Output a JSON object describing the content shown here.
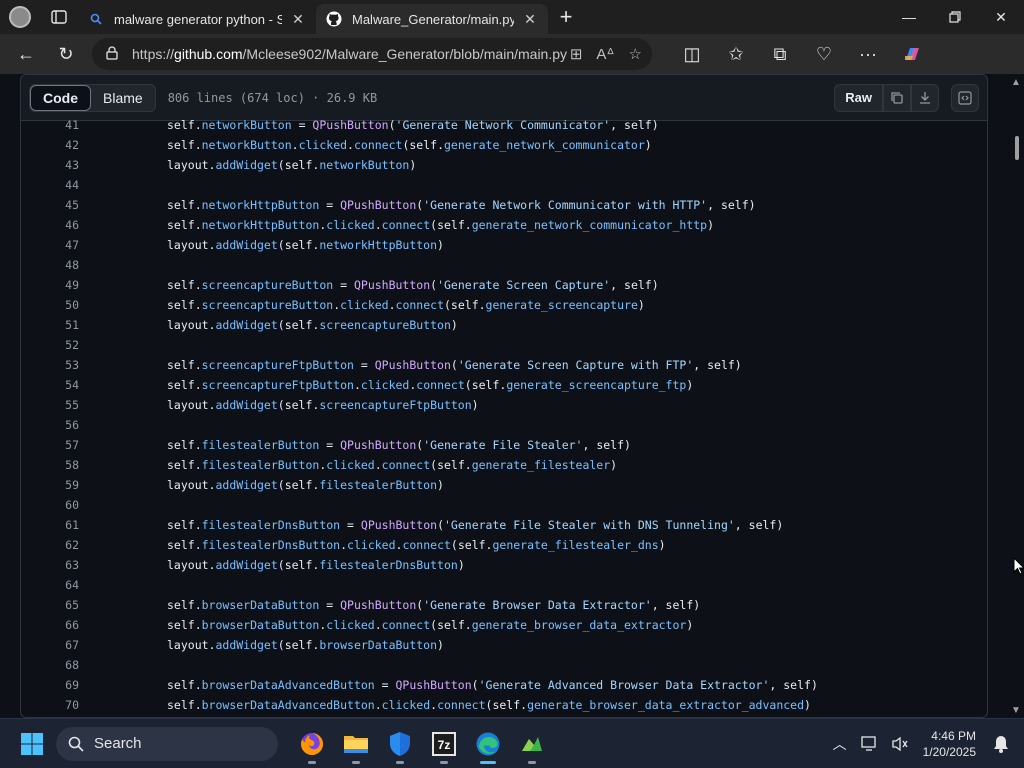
{
  "browser": {
    "tabs": [
      {
        "title": "malware generator python - Sear",
        "favicon": "search-icon",
        "active": false
      },
      {
        "title": "Malware_Generator/main.py at m",
        "favicon": "github-icon",
        "active": true
      }
    ],
    "address": {
      "scheme": "https://",
      "host": "github.com",
      "path": "/Mcleese902/Malware_Generator/blob/main/main.py"
    }
  },
  "file": {
    "tabs": [
      "Code",
      "Blame"
    ],
    "selected_tab": "Code",
    "meta": "806 lines (674 loc) · 26.9 KB",
    "raw_label": "Raw"
  },
  "code_lines": [
    {
      "n": "41",
      "tokens": [
        [
          "self.",
          "kw"
        ],
        [
          "networkButton",
          "attr"
        ],
        [
          " = ",
          "kw"
        ],
        [
          "QPushButton",
          "fn"
        ],
        [
          "(",
          "kw"
        ],
        [
          "'Generate Network Communicator'",
          "str"
        ],
        [
          ", self)",
          "kw"
        ]
      ]
    },
    {
      "n": "42",
      "tokens": [
        [
          "self.",
          "kw"
        ],
        [
          "networkButton",
          "attr"
        ],
        [
          ".",
          "kw"
        ],
        [
          "clicked",
          "attr"
        ],
        [
          ".",
          "kw"
        ],
        [
          "connect",
          "attr"
        ],
        [
          "(self.",
          "kw"
        ],
        [
          "generate_network_communicator",
          "attr"
        ],
        [
          ")",
          "kw"
        ]
      ]
    },
    {
      "n": "43",
      "tokens": [
        [
          "layout.",
          "kw"
        ],
        [
          "addWidget",
          "attr"
        ],
        [
          "(self.",
          "kw"
        ],
        [
          "networkButton",
          "attr"
        ],
        [
          ")",
          "kw"
        ]
      ]
    },
    {
      "n": "44",
      "tokens": []
    },
    {
      "n": "45",
      "tokens": [
        [
          "self.",
          "kw"
        ],
        [
          "networkHttpButton",
          "attr"
        ],
        [
          " = ",
          "kw"
        ],
        [
          "QPushButton",
          "fn"
        ],
        [
          "(",
          "kw"
        ],
        [
          "'Generate Network Communicator with HTTP'",
          "str"
        ],
        [
          ", self)",
          "kw"
        ]
      ]
    },
    {
      "n": "46",
      "tokens": [
        [
          "self.",
          "kw"
        ],
        [
          "networkHttpButton",
          "attr"
        ],
        [
          ".",
          "kw"
        ],
        [
          "clicked",
          "attr"
        ],
        [
          ".",
          "kw"
        ],
        [
          "connect",
          "attr"
        ],
        [
          "(self.",
          "kw"
        ],
        [
          "generate_network_communicator_http",
          "attr"
        ],
        [
          ")",
          "kw"
        ]
      ]
    },
    {
      "n": "47",
      "tokens": [
        [
          "layout.",
          "kw"
        ],
        [
          "addWidget",
          "attr"
        ],
        [
          "(self.",
          "kw"
        ],
        [
          "networkHttpButton",
          "attr"
        ],
        [
          ")",
          "kw"
        ]
      ]
    },
    {
      "n": "48",
      "tokens": []
    },
    {
      "n": "49",
      "tokens": [
        [
          "self.",
          "kw"
        ],
        [
          "screencaptureButton",
          "attr"
        ],
        [
          " = ",
          "kw"
        ],
        [
          "QPushButton",
          "fn"
        ],
        [
          "(",
          "kw"
        ],
        [
          "'Generate Screen Capture'",
          "str"
        ],
        [
          ", self)",
          "kw"
        ]
      ]
    },
    {
      "n": "50",
      "tokens": [
        [
          "self.",
          "kw"
        ],
        [
          "screencaptureButton",
          "attr"
        ],
        [
          ".",
          "kw"
        ],
        [
          "clicked",
          "attr"
        ],
        [
          ".",
          "kw"
        ],
        [
          "connect",
          "attr"
        ],
        [
          "(self.",
          "kw"
        ],
        [
          "generate_screencapture",
          "attr"
        ],
        [
          ")",
          "kw"
        ]
      ]
    },
    {
      "n": "51",
      "tokens": [
        [
          "layout.",
          "kw"
        ],
        [
          "addWidget",
          "attr"
        ],
        [
          "(self.",
          "kw"
        ],
        [
          "screencaptureButton",
          "attr"
        ],
        [
          ")",
          "kw"
        ]
      ]
    },
    {
      "n": "52",
      "tokens": []
    },
    {
      "n": "53",
      "tokens": [
        [
          "self.",
          "kw"
        ],
        [
          "screencaptureFtpButton",
          "attr"
        ],
        [
          " = ",
          "kw"
        ],
        [
          "QPushButton",
          "fn"
        ],
        [
          "(",
          "kw"
        ],
        [
          "'Generate Screen Capture with FTP'",
          "str"
        ],
        [
          ", self)",
          "kw"
        ]
      ]
    },
    {
      "n": "54",
      "tokens": [
        [
          "self.",
          "kw"
        ],
        [
          "screencaptureFtpButton",
          "attr"
        ],
        [
          ".",
          "kw"
        ],
        [
          "clicked",
          "attr"
        ],
        [
          ".",
          "kw"
        ],
        [
          "connect",
          "attr"
        ],
        [
          "(self.",
          "kw"
        ],
        [
          "generate_screencapture_ftp",
          "attr"
        ],
        [
          ")",
          "kw"
        ]
      ]
    },
    {
      "n": "55",
      "tokens": [
        [
          "layout.",
          "kw"
        ],
        [
          "addWidget",
          "attr"
        ],
        [
          "(self.",
          "kw"
        ],
        [
          "screencaptureFtpButton",
          "attr"
        ],
        [
          ")",
          "kw"
        ]
      ]
    },
    {
      "n": "56",
      "tokens": []
    },
    {
      "n": "57",
      "tokens": [
        [
          "self.",
          "kw"
        ],
        [
          "filestealerButton",
          "attr"
        ],
        [
          " = ",
          "kw"
        ],
        [
          "QPushButton",
          "fn"
        ],
        [
          "(",
          "kw"
        ],
        [
          "'Generate File Stealer'",
          "str"
        ],
        [
          ", self)",
          "kw"
        ]
      ]
    },
    {
      "n": "58",
      "tokens": [
        [
          "self.",
          "kw"
        ],
        [
          "filestealerButton",
          "attr"
        ],
        [
          ".",
          "kw"
        ],
        [
          "clicked",
          "attr"
        ],
        [
          ".",
          "kw"
        ],
        [
          "connect",
          "attr"
        ],
        [
          "(self.",
          "kw"
        ],
        [
          "generate_filestealer",
          "attr"
        ],
        [
          ")",
          "kw"
        ]
      ]
    },
    {
      "n": "59",
      "tokens": [
        [
          "layout.",
          "kw"
        ],
        [
          "addWidget",
          "attr"
        ],
        [
          "(self.",
          "kw"
        ],
        [
          "filestealerButton",
          "attr"
        ],
        [
          ")",
          "kw"
        ]
      ]
    },
    {
      "n": "60",
      "tokens": []
    },
    {
      "n": "61",
      "tokens": [
        [
          "self.",
          "kw"
        ],
        [
          "filestealerDnsButton",
          "attr"
        ],
        [
          " = ",
          "kw"
        ],
        [
          "QPushButton",
          "fn"
        ],
        [
          "(",
          "kw"
        ],
        [
          "'Generate File Stealer with DNS Tunneling'",
          "str"
        ],
        [
          ", self)",
          "kw"
        ]
      ]
    },
    {
      "n": "62",
      "tokens": [
        [
          "self.",
          "kw"
        ],
        [
          "filestealerDnsButton",
          "attr"
        ],
        [
          ".",
          "kw"
        ],
        [
          "clicked",
          "attr"
        ],
        [
          ".",
          "kw"
        ],
        [
          "connect",
          "attr"
        ],
        [
          "(self.",
          "kw"
        ],
        [
          "generate_filestealer_dns",
          "attr"
        ],
        [
          ")",
          "kw"
        ]
      ]
    },
    {
      "n": "63",
      "tokens": [
        [
          "layout.",
          "kw"
        ],
        [
          "addWidget",
          "attr"
        ],
        [
          "(self.",
          "kw"
        ],
        [
          "filestealerDnsButton",
          "attr"
        ],
        [
          ")",
          "kw"
        ]
      ]
    },
    {
      "n": "64",
      "tokens": []
    },
    {
      "n": "65",
      "tokens": [
        [
          "self.",
          "kw"
        ],
        [
          "browserDataButton",
          "attr"
        ],
        [
          " = ",
          "kw"
        ],
        [
          "QPushButton",
          "fn"
        ],
        [
          "(",
          "kw"
        ],
        [
          "'Generate Browser Data Extractor'",
          "str"
        ],
        [
          ", self)",
          "kw"
        ]
      ]
    },
    {
      "n": "66",
      "tokens": [
        [
          "self.",
          "kw"
        ],
        [
          "browserDataButton",
          "attr"
        ],
        [
          ".",
          "kw"
        ],
        [
          "clicked",
          "attr"
        ],
        [
          ".",
          "kw"
        ],
        [
          "connect",
          "attr"
        ],
        [
          "(self.",
          "kw"
        ],
        [
          "generate_browser_data_extractor",
          "attr"
        ],
        [
          ")",
          "kw"
        ]
      ]
    },
    {
      "n": "67",
      "tokens": [
        [
          "layout.",
          "kw"
        ],
        [
          "addWidget",
          "attr"
        ],
        [
          "(self.",
          "kw"
        ],
        [
          "browserDataButton",
          "attr"
        ],
        [
          ")",
          "kw"
        ]
      ]
    },
    {
      "n": "68",
      "tokens": []
    },
    {
      "n": "69",
      "tokens": [
        [
          "self.",
          "kw"
        ],
        [
          "browserDataAdvancedButton",
          "attr"
        ],
        [
          " = ",
          "kw"
        ],
        [
          "QPushButton",
          "fn"
        ],
        [
          "(",
          "kw"
        ],
        [
          "'Generate Advanced Browser Data Extractor'",
          "str"
        ],
        [
          ", self)",
          "kw"
        ]
      ]
    },
    {
      "n": "70",
      "tokens": [
        [
          "self.",
          "kw"
        ],
        [
          "browserDataAdvancedButton",
          "attr"
        ],
        [
          ".",
          "kw"
        ],
        [
          "clicked",
          "attr"
        ],
        [
          ".",
          "kw"
        ],
        [
          "connect",
          "attr"
        ],
        [
          "(self.",
          "kw"
        ],
        [
          "generate_browser_data_extractor_advanced",
          "attr"
        ],
        [
          ")",
          "kw"
        ]
      ]
    }
  ],
  "taskbar": {
    "search_label": "Search",
    "apps": [
      "firefox-icon",
      "file-explorer-icon",
      "defender-icon",
      "7zip-icon",
      "edge-icon",
      "app-icon"
    ],
    "time": "4:46 PM",
    "date": "1/20/2025"
  }
}
